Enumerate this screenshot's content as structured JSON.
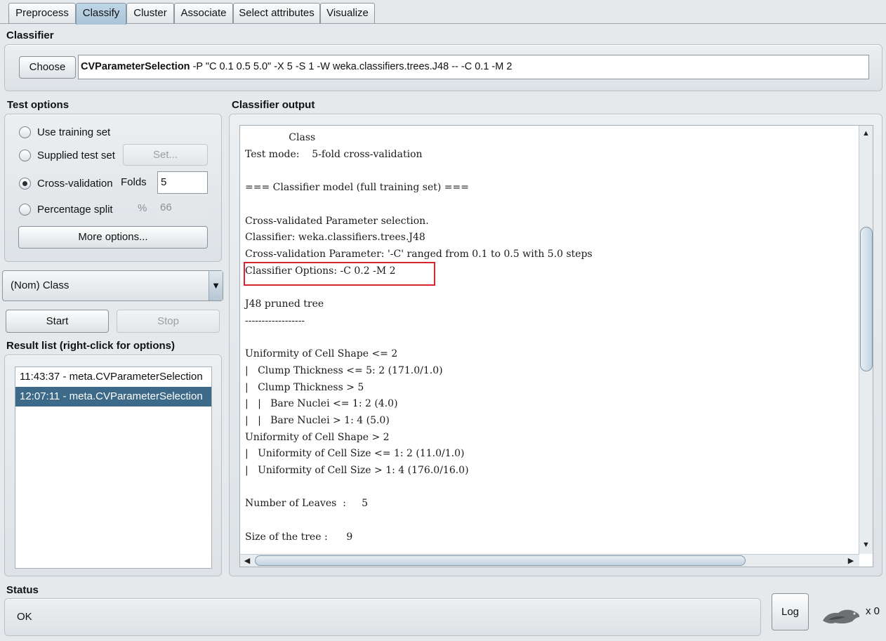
{
  "tabs": [
    "Preprocess",
    "Classify",
    "Cluster",
    "Associate",
    "Select attributes",
    "Visualize"
  ],
  "classifier": {
    "title": "Classifier",
    "choose_label": "Choose",
    "name": "CVParameterSelection",
    "options": " -P \"C 0.1 0.5 5.0\" -X 5 -S 1 -W weka.classifiers.trees.J48 -- -C 0.1 -M 2"
  },
  "test_options": {
    "title": "Test options",
    "use_training_set": "Use training set",
    "supplied_test_set": "Supplied test set",
    "set_button": "Set...",
    "cross_validation": "Cross-validation",
    "folds_label": "Folds",
    "folds_value": "5",
    "percentage_split": "Percentage split",
    "percent_symbol": "%",
    "percent_value": "66",
    "more_options": "More options...",
    "selected": "cross_validation"
  },
  "class_select": {
    "value": "(Nom) Class"
  },
  "actions": {
    "start": "Start",
    "stop": "Stop"
  },
  "result_list": {
    "title": "Result list (right-click for options)",
    "items": [
      {
        "label": "11:43:37 - meta.CVParameterSelection",
        "selected": false
      },
      {
        "label": "12:07:11 - meta.CVParameterSelection",
        "selected": true
      }
    ]
  },
  "output": {
    "title": "Classifier output",
    "lines": [
      "              Class",
      "Test mode:    5-fold cross-validation",
      "",
      "=== Classifier model (full training set) ===",
      "",
      "Cross-validated Parameter selection.",
      "Classifier: weka.classifiers.trees.J48",
      "Cross-validation Parameter: '-C' ranged from 0.1 to 0.5 with 5.0 steps",
      "Classifier Options: -C 0.2 -M 2",
      "",
      "J48 pruned tree",
      "------------------",
      "",
      "Uniformity of Cell Shape <= 2",
      "|   Clump Thickness <= 5: 2 (171.0/1.0)",
      "|   Clump Thickness > 5",
      "|   |   Bare Nuclei <= 1: 2 (4.0)",
      "|   |   Bare Nuclei > 1: 4 (5.0)",
      "Uniformity of Cell Shape > 2",
      "|   Uniformity of Cell Size <= 1: 2 (11.0/1.0)",
      "|   Uniformity of Cell Size > 1: 4 (176.0/16.0)",
      "",
      "Number of Leaves  :     5",
      "",
      "Size of the tree :      9"
    ],
    "highlight_color": "#d9262c"
  },
  "status": {
    "title": "Status",
    "text": "OK",
    "log_label": "Log",
    "task_count": "x 0"
  }
}
